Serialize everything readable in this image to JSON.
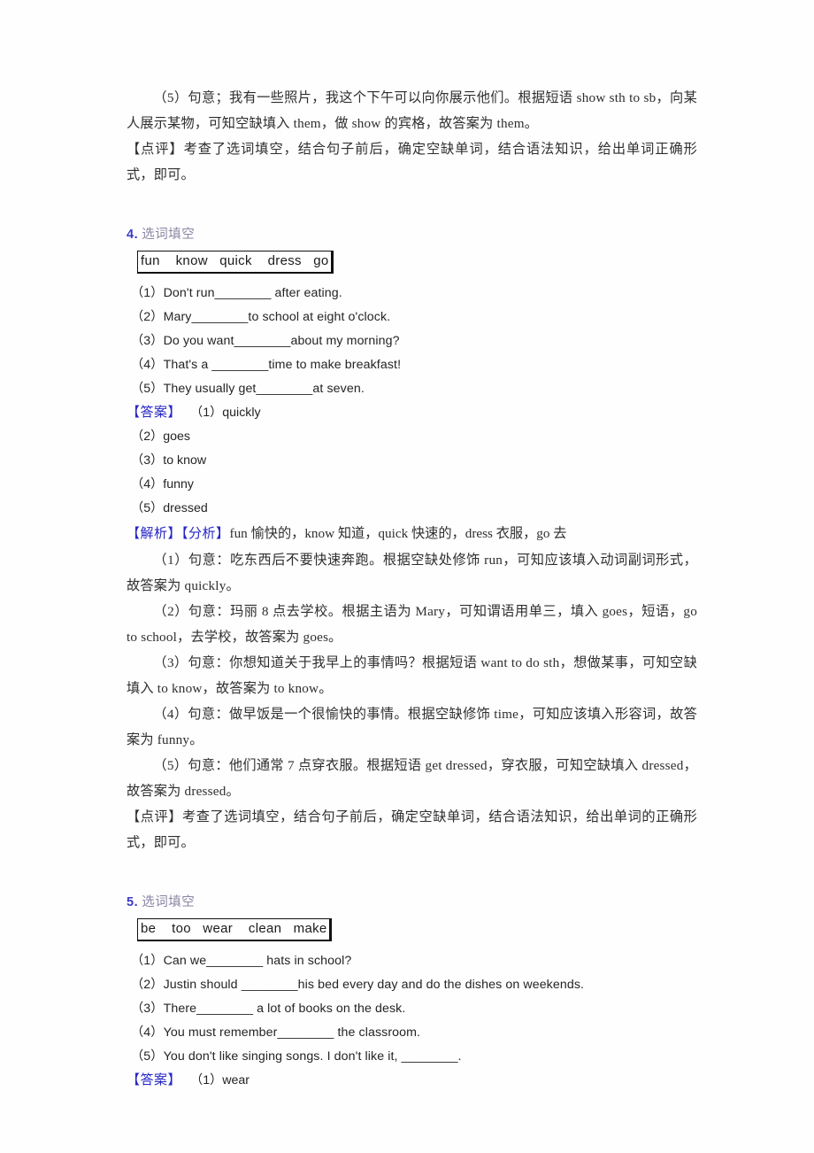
{
  "document": {
    "type": "worksheet-answer-key",
    "language": "zh-CN+en"
  },
  "top_block": {
    "explanation_5": "（5）句意；我有一些照片，我这个下午可以向你展示他们。根据短语 show sth to sb，向某人展示某物，可知空缺填入 them，做 show 的宾格，故答案为 them。",
    "comment": "【点评】考查了选词填空，结合句子前后，确定空缺单词，结合语法知识，给出单词正确形式，即可。",
    "comment_tag": "【点评】",
    "comment_body": "考查了选词填空，结合句子前后，确定空缺单词，结合语法知识，给出单词正确形式，即可。"
  },
  "section4": {
    "number": "4.",
    "title": "选词填空",
    "word_bank": "fun    know   quick    dress   go",
    "word_bank_items": [
      "fun",
      "know",
      "quick",
      "dress",
      "go"
    ],
    "questions": [
      "（1）Don't run________ after eating.",
      "（2）Mary________to school at eight o'clock.",
      "（3）Do you want________about my morning?",
      "（4）That's a ________time to make breakfast!",
      "（5）They usually get________at seven."
    ],
    "answer_tag": "【答案】",
    "answers": [
      "（1）quickly",
      "（2）goes",
      "（3）to know",
      "（4）funny",
      "（5）dressed"
    ],
    "answer_first": "（1）quickly",
    "analysis_tag": "【解析】",
    "analysis_subtag": "【分析】",
    "analysis_head_text": "fun 愉快的，know 知道，quick 快速的，dress 衣服，go 去",
    "analysis_items": [
      "（1）句意：吃东西后不要快速奔跑。根据空缺处修饰 run，可知应该填入动词副词形式，故答案为 quickly。",
      "（2）句意：玛丽 8 点去学校。根据主语为 Mary，可知谓语用单三，填入 goes，短语，go to school，去学校，故答案为 goes。",
      "（3）句意：你想知道关于我早上的事情吗？根据短语 want to do sth，想做某事，可知空缺填入 to know，故答案为 to know。",
      "（4）句意：做早饭是一个很愉快的事情。根据空缺修饰 time，可知应该填入形容词，故答案为 funny。",
      "（5）句意：他们通常 7 点穿衣服。根据短语 get dressed，穿衣服，可知空缺填入 dressed，故答案为 dressed。"
    ],
    "comment_tag": "【点评】",
    "comment_body": "考查了选词填空，结合句子前后，确定空缺单词，结合语法知识，给出单词的正确形式，即可。"
  },
  "section5": {
    "number": "5.",
    "title": "选词填空",
    "word_bank": "be    too   wear    clean   make",
    "word_bank_items": [
      "be",
      "too",
      "wear",
      "clean",
      "make"
    ],
    "questions": [
      "（1）Can we________ hats in school?",
      "（2）Justin should ________his bed every day and do the dishes on weekends.",
      "（3）There________ a lot of books on the desk.",
      "（4）You must remember________ the classroom.",
      "（5）You don't like singing songs. I don't like it, ________."
    ],
    "answer_tag": "【答案】",
    "answer_first": "（1）wear"
  },
  "colors": {
    "section_number": "#3b3bc4",
    "section_title": "#8b86a4",
    "tag_blue": "#2525c6",
    "body_text": "#2e2e2e",
    "box_border": "#111111",
    "page_background": "#fefefe"
  }
}
